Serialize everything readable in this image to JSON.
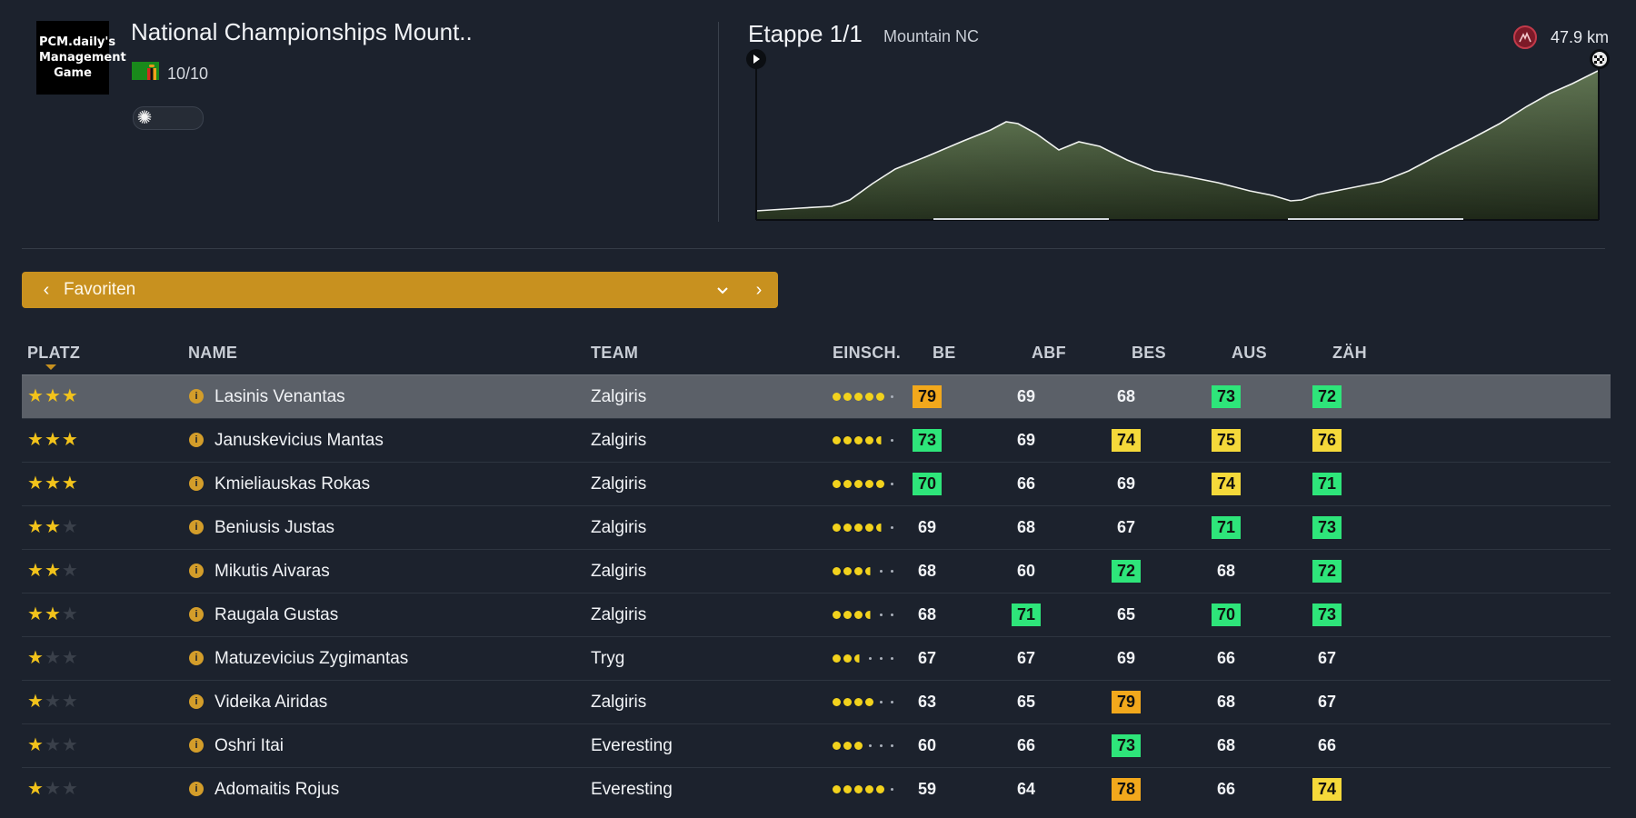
{
  "header": {
    "logo_text": "PCM.daily's Management Game",
    "race_title": "National Championships Mount..",
    "race_count": "10/10",
    "weather_icon": "sun-icon"
  },
  "stage": {
    "title": "Etappe 1/1",
    "type": "Mountain NC",
    "distance": "47.9 km"
  },
  "filter": {
    "label": "Favoriten"
  },
  "table": {
    "columns": [
      "PLATZ",
      "NAME",
      "TEAM",
      "EINSCH.",
      "BE",
      "ABF",
      "BES",
      "AUS",
      "ZÄH"
    ],
    "sorted_column": "PLATZ",
    "rows": [
      {
        "stars": 3,
        "name": "Lasinis Venantas",
        "team": "Zalgiris",
        "form": [
          1,
          1,
          1,
          1,
          1,
          0
        ],
        "stats": [
          79,
          69,
          68,
          73,
          72
        ],
        "hl": [
          "orange",
          "",
          "",
          "green",
          "green"
        ]
      },
      {
        "stars": 3,
        "name": "Januskevicius Mantas",
        "team": "Zalgiris",
        "form": [
          1,
          1,
          1,
          1,
          0.5,
          0
        ],
        "stats": [
          73,
          69,
          74,
          75,
          76
        ],
        "hl": [
          "green",
          "",
          "yellow",
          "yellow",
          "yellow"
        ]
      },
      {
        "stars": 3,
        "name": "Kmieliauskas Rokas",
        "team": "Zalgiris",
        "form": [
          1,
          1,
          1,
          1,
          1,
          0
        ],
        "stats": [
          70,
          66,
          69,
          74,
          71
        ],
        "hl": [
          "green",
          "",
          "",
          "yellow",
          "green"
        ]
      },
      {
        "stars": 2,
        "name": "Beniusis Justas",
        "team": "Zalgiris",
        "form": [
          1,
          1,
          1,
          1,
          0.5,
          0
        ],
        "stats": [
          69,
          68,
          67,
          71,
          73
        ],
        "hl": [
          "",
          "",
          "",
          "green",
          "green"
        ]
      },
      {
        "stars": 2,
        "name": "Mikutis Aivaras",
        "team": "Zalgiris",
        "form": [
          1,
          1,
          1,
          0.5,
          0,
          0
        ],
        "stats": [
          68,
          60,
          72,
          68,
          72
        ],
        "hl": [
          "",
          "",
          "green",
          "",
          "green"
        ]
      },
      {
        "stars": 2,
        "name": "Raugala Gustas",
        "team": "Zalgiris",
        "form": [
          1,
          1,
          1,
          0.5,
          0,
          0
        ],
        "stats": [
          68,
          71,
          65,
          70,
          73
        ],
        "hl": [
          "",
          "green",
          "",
          "green",
          "green"
        ]
      },
      {
        "stars": 1,
        "name": "Matuzevicius Zygimantas",
        "team": "Tryg",
        "form": [
          1,
          1,
          0.5,
          0,
          0,
          0
        ],
        "stats": [
          67,
          67,
          69,
          66,
          67
        ],
        "hl": [
          "",
          "",
          "",
          "",
          ""
        ]
      },
      {
        "stars": 1,
        "name": "Videika Airidas",
        "team": "Zalgiris",
        "form": [
          1,
          1,
          1,
          1,
          0,
          0
        ],
        "stats": [
          63,
          65,
          79,
          68,
          67
        ],
        "hl": [
          "",
          "",
          "orange",
          "",
          ""
        ]
      },
      {
        "stars": 1,
        "name": "Oshri Itai",
        "team": "Everesting",
        "form": [
          1,
          1,
          1,
          0,
          0,
          0
        ],
        "stats": [
          60,
          66,
          73,
          68,
          66
        ],
        "hl": [
          "",
          "",
          "green",
          "",
          ""
        ]
      },
      {
        "stars": 1,
        "name": "Adomaitis Rojus",
        "team": "Everesting",
        "form": [
          1,
          1,
          1,
          1,
          1,
          0
        ],
        "stats": [
          59,
          64,
          78,
          66,
          74
        ],
        "hl": [
          "",
          "",
          "orange",
          "",
          "yellow"
        ]
      }
    ]
  },
  "colors": {
    "accent": "#c8911f",
    "highlight_green": "#2ee57a",
    "highlight_yellow": "#f5d93a",
    "highlight_orange": "#f2a81c",
    "star": "#f2c31b",
    "background": "#1c222d"
  }
}
